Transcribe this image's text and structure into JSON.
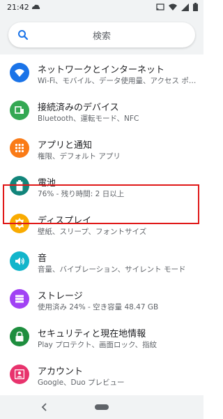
{
  "status_bar": {
    "time": "21:42"
  },
  "search": {
    "placeholder": "検索"
  },
  "settings_items": [
    {
      "title": "ネットワークとインターネット",
      "subtitle": "Wi-Fi、モバイル、データ使用量、アクセス ポ…",
      "icon": "wifi-icon",
      "color": "#1a73e8"
    },
    {
      "title": "接続済みのデバイス",
      "subtitle": "Bluetooth、運転モード、NFC",
      "icon": "connected-devices-icon",
      "color": "#34a853"
    },
    {
      "title": "アプリと通知",
      "subtitle": "権限、デフォルト アプリ",
      "icon": "apps-icon",
      "color": "#fa7b17"
    },
    {
      "title": "電池",
      "subtitle": "76% - 残り時間: 2 日以上",
      "icon": "battery-icon",
      "color": "#12857b"
    },
    {
      "title": "ディスプレイ",
      "subtitle": "壁紙、スリープ、フォントサイズ",
      "icon": "display-icon",
      "color": "#f9ab00"
    },
    {
      "title": "音",
      "subtitle": "音量、バイブレーション、サイレント モード",
      "icon": "sound-icon",
      "color": "#12b5cb"
    },
    {
      "title": "ストレージ",
      "subtitle": "使用済み 24% - 空き容量 48.47 GB",
      "icon": "storage-icon",
      "color": "#a142f4"
    },
    {
      "title": "セキュリティと現在地情報",
      "subtitle": "Play プロテクト、画面ロック、指紋",
      "icon": "lock-icon",
      "color": "#1e8e3e"
    },
    {
      "title": "アカウント",
      "subtitle": "Google、Duo プレビュー",
      "icon": "account-icon",
      "color": "#e8336d"
    }
  ],
  "highlight_color": "#e01818"
}
